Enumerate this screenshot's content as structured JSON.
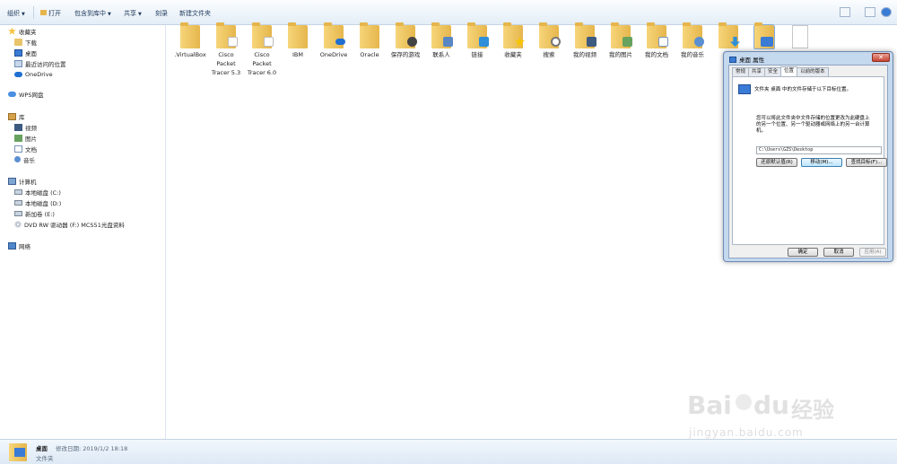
{
  "toolbar": {
    "organize": "组织",
    "open": "打开",
    "include_in_library": "包含到库中",
    "share": "共享",
    "burn": "刻录",
    "new_folder": "新建文件夹"
  },
  "nav": {
    "favorites": "收藏夹",
    "favorites_items": [
      "下载",
      "桌面",
      "最近访问的位置",
      "OneDrive"
    ],
    "wps": "WPS网盘",
    "libraries": "库",
    "library_items": [
      "视频",
      "图片",
      "文档",
      "音乐"
    ],
    "computer": "计算机",
    "computer_items": [
      "本地磁盘 (C:)",
      "本地磁盘 (D:)",
      "新加卷 (E:)",
      "DVD RW 驱动器 (F:) MCS51光盘资料"
    ],
    "network": "网络"
  },
  "files": [
    {
      "label": ".VirtualBox",
      "icon": "folder"
    },
    {
      "label": "Cisco Packet Tracer 5.3",
      "icon": "folder-paper"
    },
    {
      "label": "Cisco Packet Tracer 6.0",
      "icon": "folder-paper"
    },
    {
      "label": "IBM",
      "icon": "folder"
    },
    {
      "label": "OneDrive",
      "icon": "folder-cloud"
    },
    {
      "label": "Oracle",
      "icon": "folder"
    },
    {
      "label": "保存的游戏",
      "icon": "folder-games"
    },
    {
      "label": "联系人",
      "icon": "folder-contacts"
    },
    {
      "label": "链接",
      "icon": "folder-links"
    },
    {
      "label": "收藏夹",
      "icon": "folder-star"
    },
    {
      "label": "搜索",
      "icon": "folder-search"
    },
    {
      "label": "我的视频",
      "icon": "folder-video"
    },
    {
      "label": "我的图片",
      "icon": "folder-pictures"
    },
    {
      "label": "我的文档",
      "icon": "folder-documents"
    },
    {
      "label": "我的音乐",
      "icon": "folder-music"
    },
    {
      "label": "",
      "icon": "folder-download"
    },
    {
      "label": "",
      "icon": "folder-desktop-selected"
    },
    {
      "label": "",
      "icon": "blank-file"
    }
  ],
  "status": {
    "name": "桌面",
    "modified_label": "修改日期: 2019/1/2 18:18",
    "type": "文件夹"
  },
  "dialog": {
    "title": "桌面 属性",
    "close": "✕",
    "tabs": [
      "常规",
      "共享",
      "安全",
      "位置",
      "以前的版本"
    ],
    "active_tab": "位置",
    "heading": "文件夹 桌面 中的文件存储于以下目标位置。",
    "desc_line1": "您可以将此文件夹中文件存储的位置更改为此硬盘上",
    "desc_line2": "的另一个位置、另一个驱动器或网络上的另一台计算",
    "desc_line3": "机。",
    "path": "C:\\Users\\GZS\\Desktop",
    "restore_default": "还原默认值(R)",
    "move": "移动(M)...",
    "find_target": "查找目标(F)...",
    "ok": "确定",
    "cancel": "取消",
    "apply": "应用(A)"
  },
  "watermark": {
    "brand": "Bai",
    "brand2": "du",
    "cn": "经验",
    "url": "jingyan.baidu.com"
  },
  "colors": {
    "toolbar_text": "#1e395b",
    "dialog_frame": "#c4d8ee",
    "folder": "#e6b64c",
    "accent_blue": "#3a7bd5"
  }
}
